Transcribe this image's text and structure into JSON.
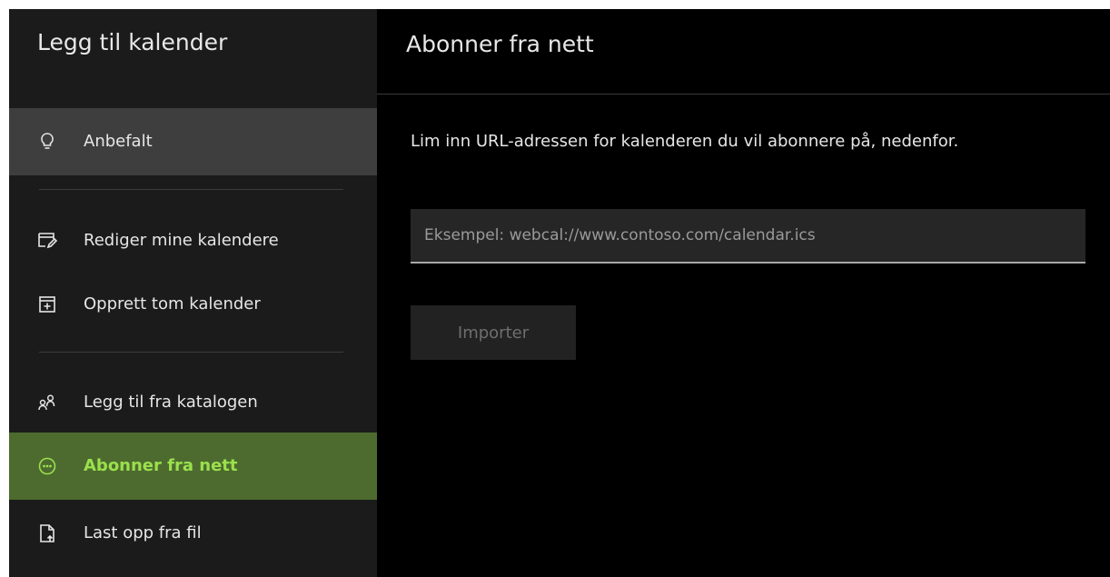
{
  "sidebar": {
    "title": "Legg til kalender",
    "items": [
      {
        "label": "Anbefalt",
        "icon": "lightbulb-icon",
        "state": "hover"
      },
      {
        "label": "Rediger mine kalendere",
        "icon": "edit-calendar-icon"
      },
      {
        "label": "Opprett tom kalender",
        "icon": "calendar-add-icon"
      },
      {
        "label": "Legg til fra katalogen",
        "icon": "people-directory-icon"
      },
      {
        "label": "Abonner fra nett",
        "icon": "subscribe-web-icon",
        "state": "selected"
      },
      {
        "label": "Last opp fra fil",
        "icon": "file-upload-icon"
      }
    ]
  },
  "main": {
    "title": "Abonner fra nett",
    "instructions": "Lim inn URL-adressen for kalenderen du vil abonnere på, nedenfor.",
    "url_input": {
      "value": "",
      "placeholder": "Eksempel: webcal://www.contoso.com/calendar.ics"
    },
    "import_button_label": "Importer"
  },
  "colors": {
    "sidebar_bg": "#1b1b1b",
    "main_bg": "#000000",
    "hover_bg": "#3e3e3e",
    "selected_bg": "#4d6b2f",
    "selected_text": "#9be04d"
  }
}
